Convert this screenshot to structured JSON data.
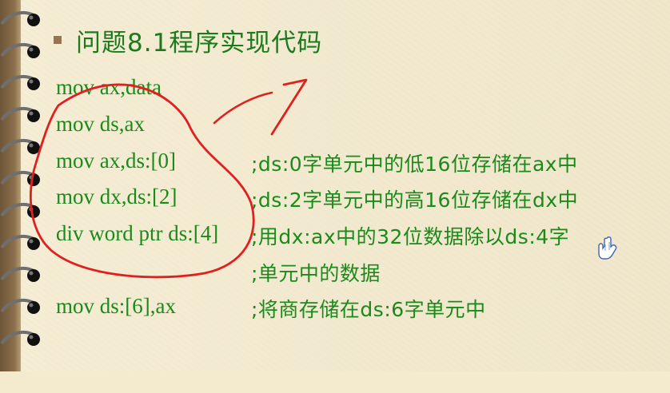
{
  "slide": {
    "title": "问题8.1程序实现代码",
    "code_lines": [
      {
        "code": "mov ax,data",
        "comment": ""
      },
      {
        "code": "mov ds,ax",
        "comment": ""
      },
      {
        "code": "mov ax,ds:[0]",
        "comment": ";ds:0字单元中的低16位存储在ax中"
      },
      {
        "code": "mov dx,ds:[2]",
        "comment": ";ds:2字单元中的高16位存储在dx中"
      },
      {
        "code": "div word ptr ds:[4]",
        "comment": ";用dx:ax中的32位数据除以ds:4字"
      },
      {
        "code": "",
        "comment": ";单元中的数据"
      },
      {
        "code": "mov ds:[6],ax",
        "comment": ";将商存储在ds:6字单元中"
      }
    ]
  },
  "colors": {
    "background": "#f4ebcf",
    "text": "#1b8a1b",
    "annotation": "#e02020",
    "bullet": "#9b7250"
  },
  "icons": {
    "cursor": "hand-pointer-icon",
    "binding": "spiral-ring-icon",
    "bullet": "square-bullet-icon"
  }
}
